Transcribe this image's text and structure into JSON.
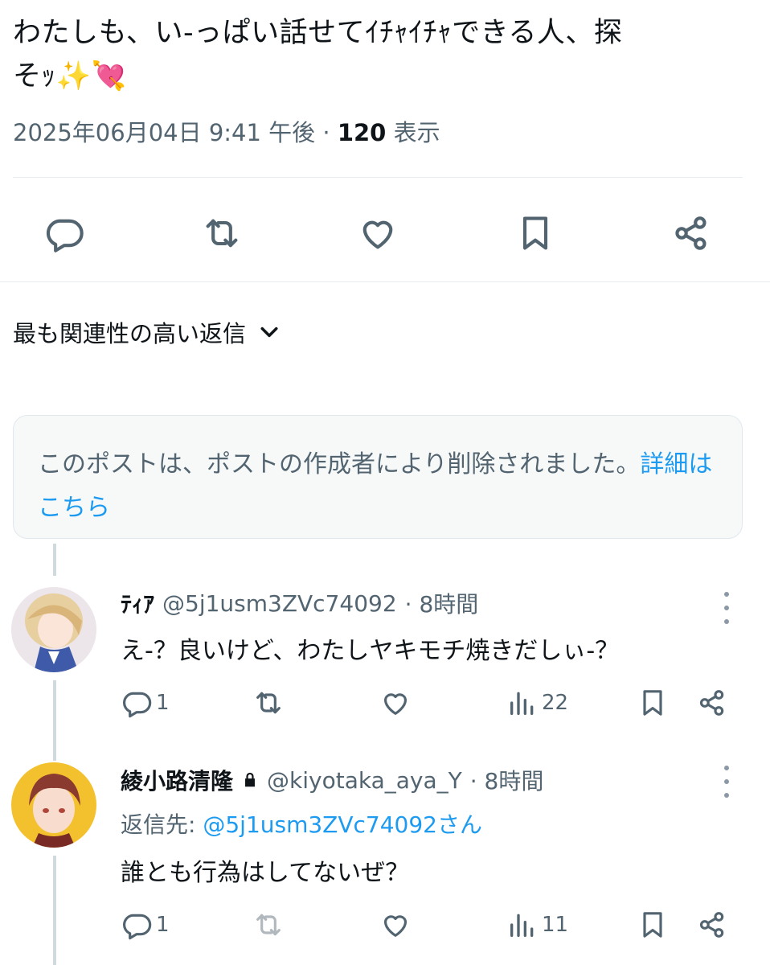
{
  "post": {
    "text_line1": "わたしも、い-っぱい話せてｲﾁｬｲﾁｬできる人、探",
    "text_line2": "そｯ",
    "emoji_sparkles": "✨",
    "emoji_heart": "💘",
    "date": "2025年06月04日 9:41 午後",
    "dot": "·",
    "views_count": "120",
    "views_label": "表示"
  },
  "sort": {
    "label": "最も関連性の高い返信"
  },
  "deleted": {
    "text": "このポストは、ポストの作成者により削除されました。",
    "link": "詳細はこちら"
  },
  "replies": [
    {
      "name": "ﾃｨｱ",
      "handle": "@5j1usm3ZVc74092",
      "time": "· 8時間",
      "text": "え-？良いけど、わたしヤキモチ焼きだしぃ-？",
      "reply_count": "1",
      "views": "22"
    },
    {
      "name": "綾小路清隆",
      "handle": "@kiyotaka_aya_Y",
      "time": "· 8時間",
      "reply_to_label": "返信先: ",
      "reply_to_handle": "@5j1usm3ZVc74092さん",
      "text": "誰とも行為はしてないぜ？",
      "reply_count": "1",
      "views": "11"
    }
  ],
  "colors": {
    "accent": "#1d9bf0",
    "text_primary": "#0f1419",
    "text_secondary": "#536471",
    "border": "#e6ecf0"
  }
}
